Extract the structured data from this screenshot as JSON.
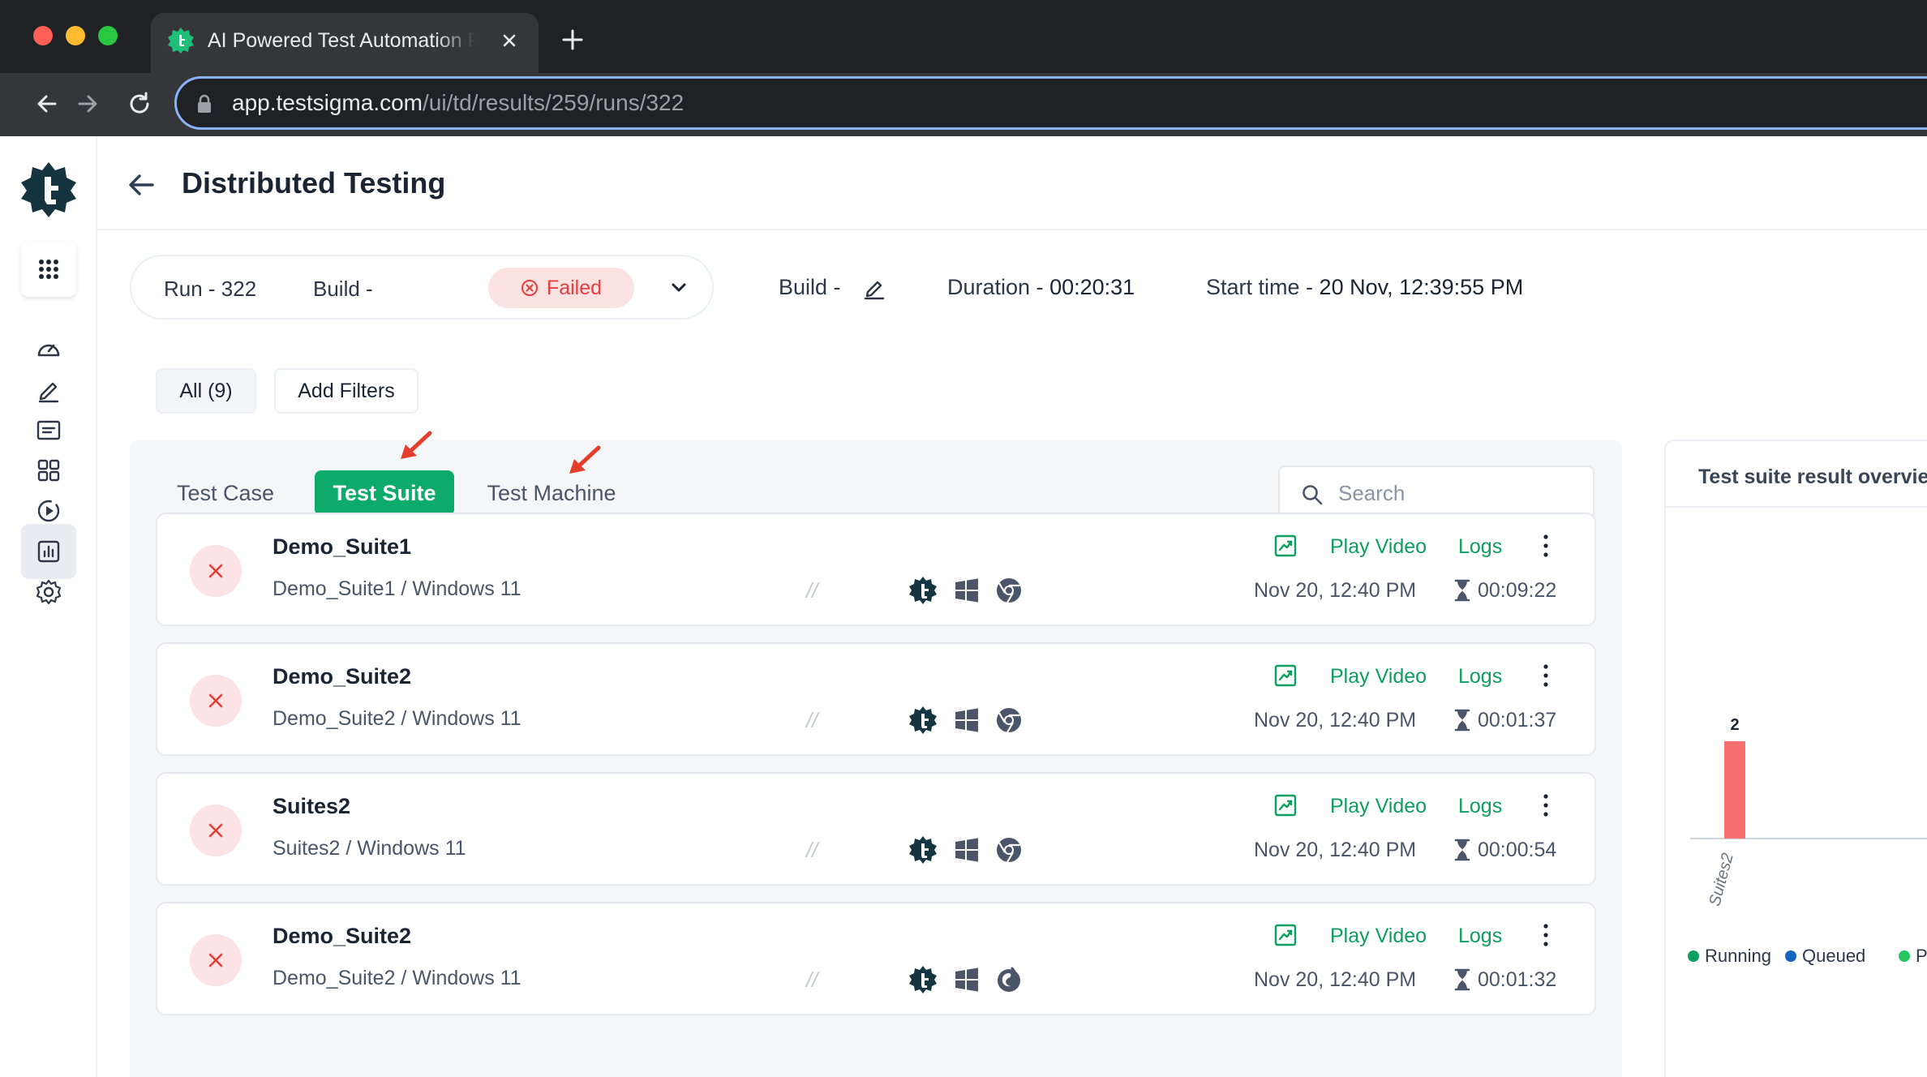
{
  "browser": {
    "tab_title": "AI Powered Test Automation Platform",
    "url_host": "app.testsigma.com",
    "url_path": "/ui/td/results/259/runs/322"
  },
  "header": {
    "title": "Distributed Testing"
  },
  "run": {
    "run_label": "Run - 322",
    "build_label": "Build -",
    "status": "Failed",
    "build2_label": "Build -",
    "duration_label": "Duration -",
    "duration_value": "00:20:31",
    "start_label": "Start time -",
    "start_value": "20 Nov, 12:39:55 PM"
  },
  "filters": {
    "all_label": "All (9)",
    "add_label": "Add Filters"
  },
  "view_tabs": [
    {
      "label": "Test Case",
      "active": false
    },
    {
      "label": "Test Suite",
      "active": true
    },
    {
      "label": "Test Machine",
      "active": false
    }
  ],
  "search": {
    "placeholder": "Search"
  },
  "suites": [
    {
      "name": "Demo_Suite1",
      "sub": "Demo_Suite1 / Windows 11",
      "browser_icon": "chrome-icon",
      "play": "Play Video",
      "logs": "Logs",
      "date": "Nov 20, 12:40 PM",
      "duration": "00:09:22",
      "divider": "//"
    },
    {
      "name": "Demo_Suite2",
      "sub": "Demo_Suite2 / Windows 11",
      "browser_icon": "chrome-icon",
      "play": "Play Video",
      "logs": "Logs",
      "date": "Nov 20, 12:40 PM",
      "duration": "00:01:37",
      "divider": "//"
    },
    {
      "name": "Suites2",
      "sub": "Suites2 / Windows 11",
      "browser_icon": "chrome-icon",
      "play": "Play Video",
      "logs": "Logs",
      "date": "Nov 20, 12:40 PM",
      "duration": "00:00:54",
      "divider": "//"
    },
    {
      "name": "Demo_Suite2",
      "sub": "Demo_Suite2 / Windows 11",
      "browser_icon": "firefox-icon",
      "play": "Play Video",
      "logs": "Logs",
      "date": "Nov 20, 12:40 PM",
      "duration": "00:01:32",
      "divider": "//"
    }
  ],
  "overview": {
    "title": "Test suite result overview",
    "chart_data": {
      "type": "bar",
      "categories": [
        "Suites2"
      ],
      "values": [
        2
      ],
      "ylim": [
        0,
        2
      ]
    },
    "legend": [
      {
        "label": "Running",
        "color": "#0c9f5f"
      },
      {
        "label": "Queued",
        "color": "#1565c0"
      },
      {
        "label": "Passed",
        "color": "#22c55e"
      }
    ]
  },
  "colors": {
    "brand": "#0cab6a",
    "failed": "#e53e3e",
    "bar": "#f87171"
  }
}
